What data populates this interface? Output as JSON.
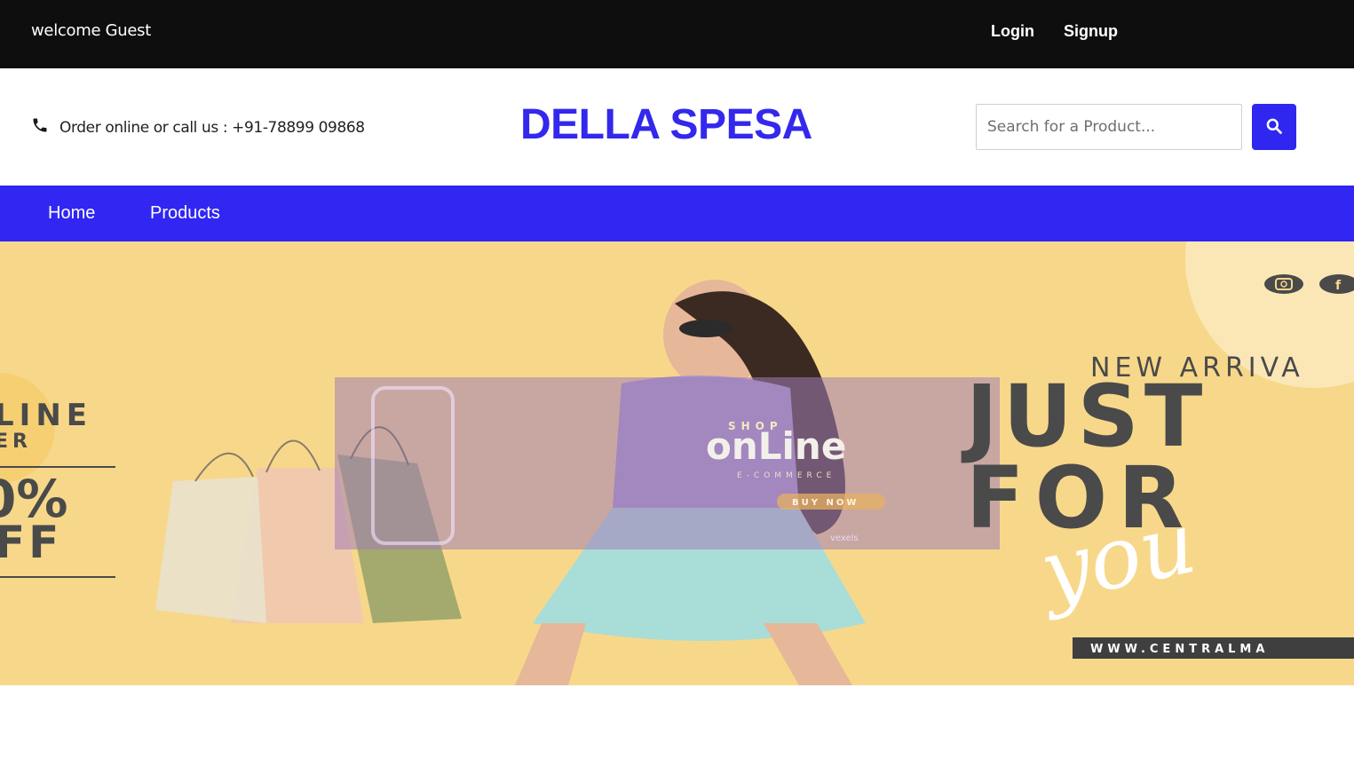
{
  "topbar": {
    "welcome": "welcome Guest",
    "login": "Login",
    "signup": "Signup"
  },
  "header": {
    "contact": "Order online or call us : +91-78899 09868",
    "brand": "DELLA SPESA",
    "search_placeholder": "Search for a Product..."
  },
  "nav": {
    "items": [
      "Home",
      "Products"
    ]
  },
  "banner": {
    "left_line1": "LINE",
    "left_line2": "ER",
    "left_percent": "0%",
    "left_off": "FF",
    "shop_text": "SHOP",
    "online_text": "onLine",
    "ecommerce_text": "E-COMMERCE",
    "buy_now": "BUY NOW",
    "vexels": "vexels",
    "new_arrival": "NEW ARRIVA",
    "just": "JUST",
    "for": "FOR",
    "you": "you",
    "website": "WWW.CENTRALMA"
  },
  "colors": {
    "topbar_bg": "#0e0e0e",
    "brand": "#3328ec",
    "accent": "#3126f2",
    "banner_bg": "#f7d88a"
  },
  "icons": {
    "phone": "phone-icon",
    "search": "search-icon",
    "instagram": "instagram-icon",
    "facebook": "facebook-icon"
  }
}
